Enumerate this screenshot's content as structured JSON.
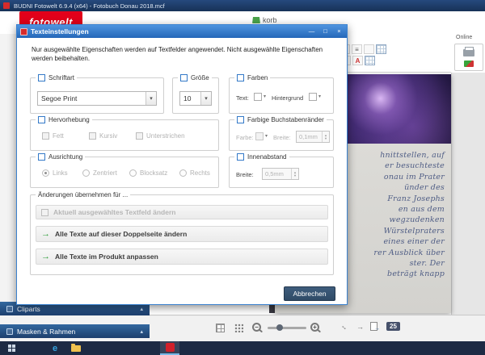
{
  "window": {
    "title": "BUDNI Fotowelt 6.9.4 (x64) - Fotobuch Donau 2018.mcf",
    "logo_text": "fotowelt",
    "cart_label": "korb",
    "online_label": "Online"
  },
  "dialog": {
    "title": "Texteinstellungen",
    "controls": {
      "minimize": "—",
      "maximize": "□",
      "close": "×"
    },
    "intro": "Nur ausgewählte Eigenschaften werden auf Textfelder angewendet. Nicht ausgewählte Eigenschaften werden beibehalten.",
    "font": {
      "label": "Schriftart",
      "value": "Segoe Print"
    },
    "size": {
      "label": "Größe",
      "value": "10"
    },
    "colors_group": {
      "label": "Farben",
      "text_label": "Text:",
      "background_label": "Hintergrund"
    },
    "emphasis": {
      "label": "Hervorhebung",
      "options": [
        "Fett",
        "Kursiv",
        "Unterstrichen"
      ]
    },
    "letter_border": {
      "label": "Farbige Buchstabenränder",
      "color_label": "Farbe:",
      "width_label": "Breite:",
      "width_value": "0,1mm"
    },
    "alignment": {
      "label": "Ausrichtung",
      "options": [
        "Links",
        "Zentriert",
        "Blocksatz",
        "Rechts"
      ],
      "selected": "Links"
    },
    "padding": {
      "label": "Innenabstand",
      "width_label": "Breite:",
      "width_value": "0,5mm"
    },
    "apply": {
      "label": "Änderungen übernehmen für ...",
      "current_disabled": "Aktuell ausgewähltes Textfeld ändern",
      "spread": "Alle Texte auf dieser Doppelseite ändern",
      "product": "Alle Texte im Produkt anpassen"
    },
    "cancel_label": "Abbrechen"
  },
  "sidebar": {
    "cliparts_label": "Cliparts",
    "masks_label": "Masken & Rahmen"
  },
  "statusbar": {
    "zoom_value": "25"
  },
  "page": {
    "text_lines": [
      "hnittstellen, auf",
      "er besuchteste",
      "onau im Prater",
      "ünder des",
      "Franz Josephs",
      "en aus dem",
      "wegzudenken",
      "Würstelpraters",
      "eines einer der",
      "rer Ausblick über",
      "ster. Der",
      "beträgt knapp"
    ]
  },
  "colors": {
    "accent_blue": "#3379c8",
    "brand_red": "#e2001a",
    "apply_green": "#2e9e3a",
    "cancel_navy": "#33506e",
    "dialog_title_blue": "#2f71c2",
    "taskbar_navy": "#1d2a44",
    "handwriting_blue": "#4f5d85"
  }
}
